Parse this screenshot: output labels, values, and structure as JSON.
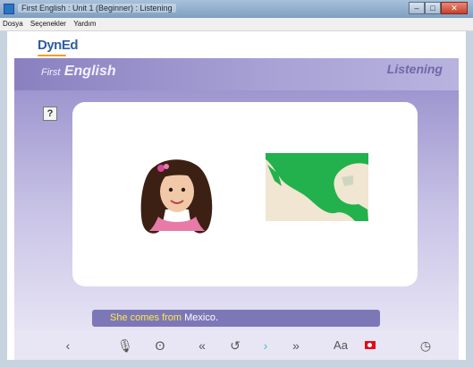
{
  "window": {
    "title": "First English : Unit 1 (Beginner) : Listening",
    "buttons": {
      "minimize": "–",
      "maximize": "□",
      "close": "✕"
    }
  },
  "menu": [
    "Dosya",
    "Seçenekler",
    "Yardım"
  ],
  "app": {
    "logo": "DynEd",
    "banner_title_first": "First",
    "banner_title_second": "English",
    "mode": "Listening"
  },
  "help_button": "?",
  "caption": {
    "part_a": "She comes from ",
    "part_b": "Mexico."
  },
  "controls": {
    "back": "‹",
    "mic": "🎙",
    "ear": "ʘ",
    "rewind": "«",
    "repeat": "↺",
    "next": "›",
    "forward": "»",
    "text": "Aa",
    "clock": "◷"
  },
  "colors": {
    "caption_highlight": "#ffe74a",
    "next_arrow": "#3ec0d8",
    "flag": "#e30a17",
    "map_green": "#22b14c"
  }
}
